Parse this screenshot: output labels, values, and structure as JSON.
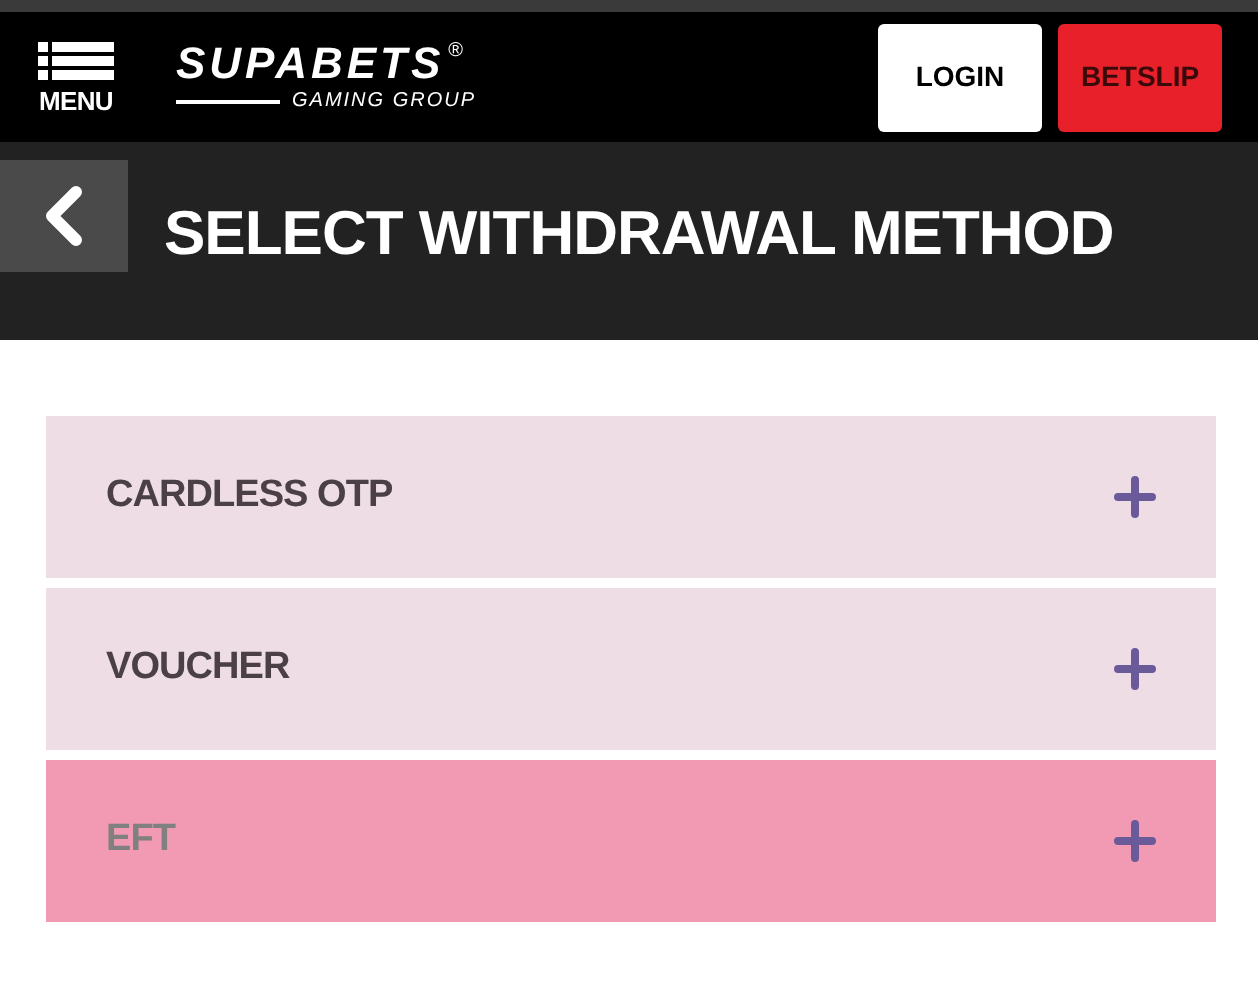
{
  "header": {
    "menu_label": "MENU",
    "logo": {
      "name": "SUPABETS",
      "mark": "®",
      "tagline": "GAMING GROUP"
    },
    "buttons": [
      {
        "label": "LOGIN",
        "kind": "login"
      },
      {
        "label": "BETSLIP",
        "kind": "betslip"
      }
    ]
  },
  "title_bar": {
    "title": "SELECT WITHDRAWAL METHOD"
  },
  "methods": [
    {
      "label": "CARDLESS OTP",
      "selected": false
    },
    {
      "label": "VOUCHER",
      "selected": false
    },
    {
      "label": "EFT",
      "selected": true
    }
  ]
}
